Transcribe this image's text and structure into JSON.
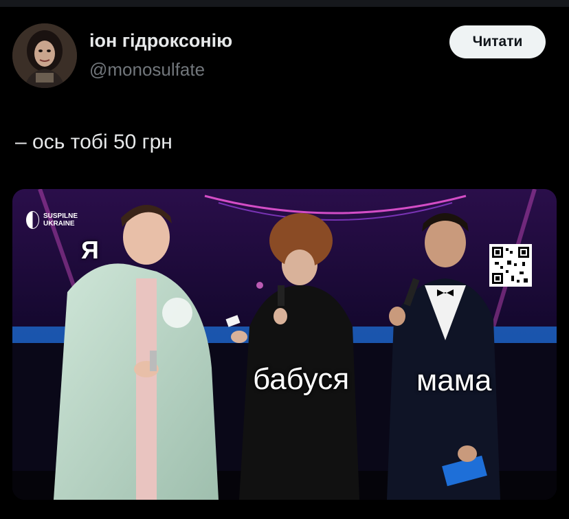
{
  "profile": {
    "display_name": "іон гідроксонію",
    "handle": "@monosulfate",
    "follow_label": "Читати",
    "avatar_icon": "avatar-photo"
  },
  "tweet": {
    "text": "– ось тобі 50 грн"
  },
  "media": {
    "brand": "SUSPILNE UKRAINE",
    "labels": {
      "me": "Я",
      "grandma": "бабуся",
      "mom": "мама"
    }
  },
  "colors": {
    "background": "#000000",
    "text_primary": "#e7e9ea",
    "text_secondary": "#71767b",
    "button_bg": "#eff3f4",
    "button_text": "#0f1419",
    "stage_accent": "#ff3ad6"
  }
}
